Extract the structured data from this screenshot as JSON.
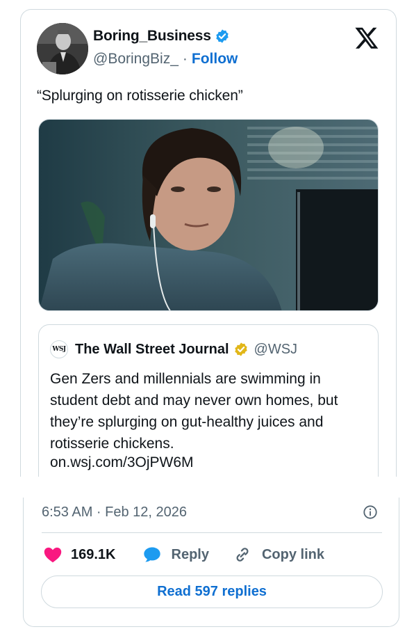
{
  "tweet": {
    "display_name": "Boring_Business",
    "handle": "@BoringBiz_",
    "separator": "·",
    "follow_label": "Follow",
    "text": "“Splurging on rotisserie chicken”"
  },
  "quote": {
    "badge": "WSJ",
    "name": "The Wall Street Journal",
    "handle": "@WSJ",
    "text": "Gen Zers and millennials are swimming in student debt and may never own homes, but they’re splurging on gut-healthy juices and rotisserie chickens.",
    "link": "on.wsj.com/3OjPW6M"
  },
  "footer": {
    "timestamp": "6:53 AM · Feb 12, 2026",
    "likes": "169.1K",
    "reply_label": "Reply",
    "copy_label": "Copy link",
    "read_replies": "Read 597 replies"
  },
  "colors": {
    "verified_blue": "#1d9bf0",
    "verified_gold": "#e2b719",
    "like_pink": "#f91880",
    "link_blue": "#0f6fd1"
  },
  "icons": [
    "verified-badge-icon",
    "x-logo-icon",
    "gold-verified-badge-icon",
    "info-icon",
    "heart-icon",
    "reply-bubble-icon",
    "link-icon"
  ]
}
